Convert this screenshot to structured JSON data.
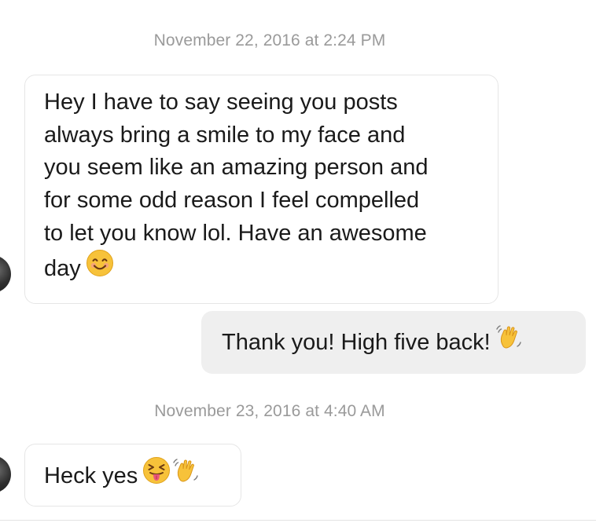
{
  "conversation": {
    "timestamps": [
      "November 22, 2016 at 2:24 PM",
      "November 23, 2016 at 4:40 AM"
    ],
    "messages": [
      {
        "direction": "incoming",
        "lines": [
          "Hey I have to say seeing you posts",
          "always bring a smile to my face and",
          "you seem like an amazing person and",
          "for some odd reason I feel compelled",
          "to let you know lol. Have an awesome",
          "day"
        ],
        "emoji": [
          "smiling-face-icon"
        ]
      },
      {
        "direction": "outgoing",
        "text": "Thank you! High five back!",
        "emoji": [
          "waving-hand-icon"
        ]
      },
      {
        "direction": "incoming",
        "text": "Heck yes",
        "emoji": [
          "squinting-tongue-face-icon",
          "waving-hand-icon"
        ]
      }
    ]
  },
  "colors": {
    "timestamp": "#9a9a9a",
    "incoming_bubble_border": "#e6e6e6",
    "outgoing_bubble_bg": "#efefef",
    "emoji_yellow": "#f7c23a"
  }
}
